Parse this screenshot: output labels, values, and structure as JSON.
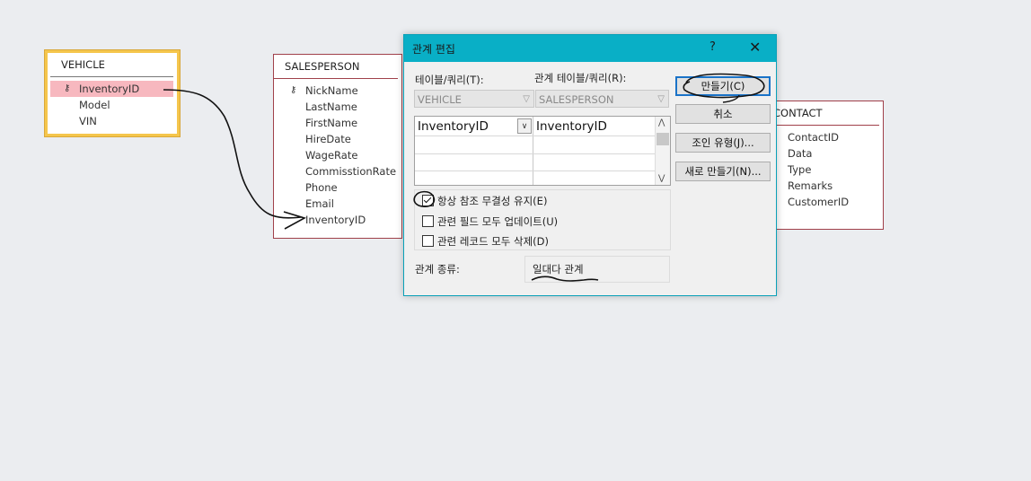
{
  "tables": {
    "vehicle": {
      "title": "VEHICLE",
      "fields": [
        "InventoryID",
        "Model",
        "VIN"
      ]
    },
    "salesperson": {
      "title": "SALESPERSON",
      "fields": [
        "NickName",
        "LastName",
        "FirstName",
        "HireDate",
        "WageRate",
        "CommisstionRate",
        "Phone",
        "Email",
        "InventoryID"
      ]
    },
    "contact": {
      "title": "CONTACT",
      "fields": [
        "ContactID",
        "Data",
        "Type",
        "Remarks",
        "CustomerID"
      ]
    }
  },
  "dialog": {
    "title": "관계 편집",
    "help": "?",
    "close": "✕",
    "table_label": "테이블/쿼리(T):",
    "related_label": "관계 테이블/쿼리(R):",
    "table_value": "VEHICLE",
    "related_value": "SALESPERSON",
    "grid": {
      "left": "InventoryID",
      "right": "InventoryID"
    },
    "checks": [
      {
        "label": "항상 참조 무결성 유지(E)",
        "checked": true
      },
      {
        "label": "관련 필드 모두 업데이트(U)",
        "checked": false
      },
      {
        "label": "관련 레코드 모두 삭제(D)",
        "checked": false
      }
    ],
    "rel_type_label": "관계 종류:",
    "rel_type_value": "일대다 관계",
    "buttons": {
      "create": "만들기(C)",
      "cancel": "취소",
      "join": "조인 유형(J)...",
      "new": "새로 만들기(N)..."
    }
  },
  "icons": {
    "key": "key-icon",
    "dropdown": "chevron-down-icon",
    "scroll_up": "scroll-up-icon",
    "scroll_down": "scroll-down-icon"
  },
  "colors": {
    "dialog_title": "#09afc6",
    "table_border": "#a0404a",
    "selection": "#f7b8bf",
    "highlight": "#f5c64c"
  }
}
